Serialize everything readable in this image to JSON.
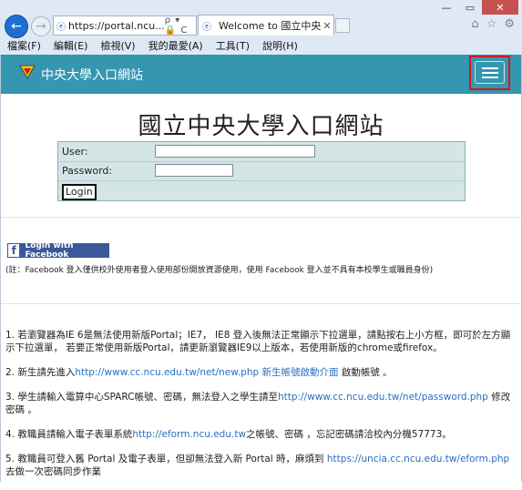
{
  "browser": {
    "address": "https://portal.ncu...",
    "address_tools": "ρ ▾ 🔒 C",
    "tab_title": "Welcome to 國立中央大學...",
    "menu": [
      "檔案(F)",
      "編輯(E)",
      "檢視(V)",
      "我的最愛(A)",
      "工具(T)",
      "說明(H)"
    ]
  },
  "navbar": {
    "brand": "中央大學入口網站"
  },
  "page": {
    "title": "國立中央大學入口網站",
    "login": {
      "user_label": "User:",
      "password_label": "Password:",
      "button": "Login"
    },
    "facebook": {
      "button": "Login with Facebook",
      "note": "(註：Facebook 登入僅供校外使用者登入使用部份開放資源使用，使用 Facebook 登入並不具有本校學生或職員身份)"
    }
  },
  "notes": [
    {
      "pre": "1. 若瀏覽器為IE 6是無法使用新版Portal；IE7， IE8 登入後無法正常顯示下拉選單，請點按右上小方框，即可於左方顯示下拉選單， 若要正常使用新版Portal，請更新瀏覽器IE9以上版本，若使用新版的chrome或firefox。",
      "link": "",
      "post": ""
    },
    {
      "pre": "2. 新生請先進入",
      "link": "http://www.cc.ncu.edu.tw/net/new.php 新生帳號啟動介面",
      "post": " 啟動帳號 。"
    },
    {
      "pre": "3. 學生請輸入電算中心SPARC帳號、密碼，無法登入之學生請至",
      "link": "http://www.cc.ncu.edu.tw/net/password.php",
      "post": " 修改密碼 。"
    },
    {
      "pre": "4. 教職員請輸入電子表單系統",
      "link": "http://eform.ncu.edu.tw",
      "post": "之帳號、密碼 ，忘記密碼請洽校內分機57773。"
    },
    {
      "pre": "5. 教職員可登入舊 Portal 及電子表單，但卻無法登入新 Portal 時，麻煩到 ",
      "link": "https://uncia.cc.ncu.edu.tw/eform.php",
      "post": " 去做一次密碼同步作業"
    }
  ]
}
